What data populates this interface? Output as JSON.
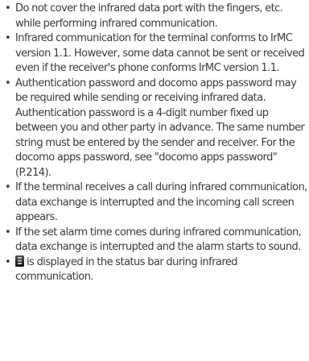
{
  "notes": [
    "Do not cover the infrared data port with the fingers, etc. while performing infrared communication.",
    "Infrared communication for the terminal conforms to IrMC version 1.1. However, some data cannot be sent or received even if the receiver's phone conforms IrMC version 1.1.",
    "Authentication password and docomo apps password may be required while sending or receiving infrared data. Authentication password is a 4-digit number fixed up between you and other party in advance. The same number string must be entered by the sender and receiver. For the docomo apps password, see \"docomo apps password\" (P.214).",
    "If the terminal receives a call during infrared communication, data exchange is interrupted and the incoming call screen appears.",
    "If the set alarm time comes during infrared communication, data exchange is interrupted and the alarm starts to sound.",
    "is displayed in the status bar during infrared communication."
  ],
  "bullet": "•",
  "status_icon": "infrared-status-icon"
}
